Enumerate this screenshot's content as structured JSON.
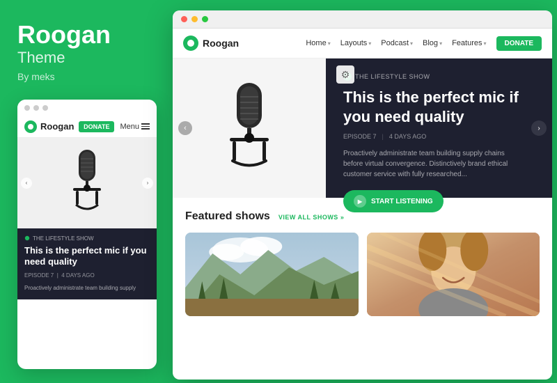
{
  "brand": {
    "title": "Roogan",
    "subtitle": "Theme",
    "author": "By meks"
  },
  "mobile_preview": {
    "topbar_dots": [
      "gray",
      "gray",
      "gray"
    ],
    "nav": {
      "logo": "Roogan",
      "donate_label": "DONATE",
      "menu_label": "Menu"
    },
    "hero": {
      "label": "THE LIFESTYLE SHOW",
      "title": "This is the perfect mic if you need quality",
      "episode": "EPISODE 7",
      "time_ago": "4 DAYS AGO"
    },
    "description": "Proactively administrate team building supply"
  },
  "browser": {
    "nav": {
      "logo": "Roogan",
      "items": [
        {
          "label": "Home",
          "has_dropdown": true
        },
        {
          "label": "Layouts",
          "has_dropdown": true
        },
        {
          "label": "Podcast",
          "has_dropdown": true
        },
        {
          "label": "Blog",
          "has_dropdown": true
        },
        {
          "label": "Features",
          "has_dropdown": true
        }
      ],
      "donate_label": "DONATE"
    },
    "hero": {
      "label": "THE LIFESTYLE SHOW",
      "title": "This is the perfect mic if you need quality",
      "episode": "EPISODE 7",
      "time_ago": "4 DAYS AGO",
      "description": "Proactively administrate team building supply chains before virtual convergence. Distinctively brand ethical customer service with fully researched...",
      "start_label": "START LISTENING"
    },
    "featured": {
      "title": "Featured shows",
      "view_all": "VIEW ALL SHOWS »"
    }
  }
}
